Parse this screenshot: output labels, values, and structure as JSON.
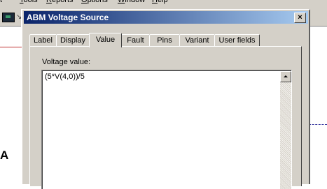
{
  "menubar": {
    "items": [
      {
        "label": "t",
        "key": ""
      },
      {
        "label": "ools",
        "key": "T"
      },
      {
        "label": "eports",
        "key": "R"
      },
      {
        "label": "ptions",
        "key": "O"
      },
      {
        "label": "indow",
        "key": "W"
      },
      {
        "label": "elp",
        "key": "H"
      }
    ]
  },
  "schematic": {
    "letter": "A"
  },
  "dialog": {
    "title": "ABM Voltage Source",
    "close_label": "×",
    "tabs": [
      {
        "label": "Label"
      },
      {
        "label": "Display"
      },
      {
        "label": "Value",
        "active": true
      },
      {
        "label": "Fault"
      },
      {
        "label": "Pins"
      },
      {
        "label": "Variant"
      },
      {
        "label": "User fields"
      }
    ],
    "voltage_label": "Voltage value:",
    "voltage_value": "(5*V(4,0))/5"
  }
}
